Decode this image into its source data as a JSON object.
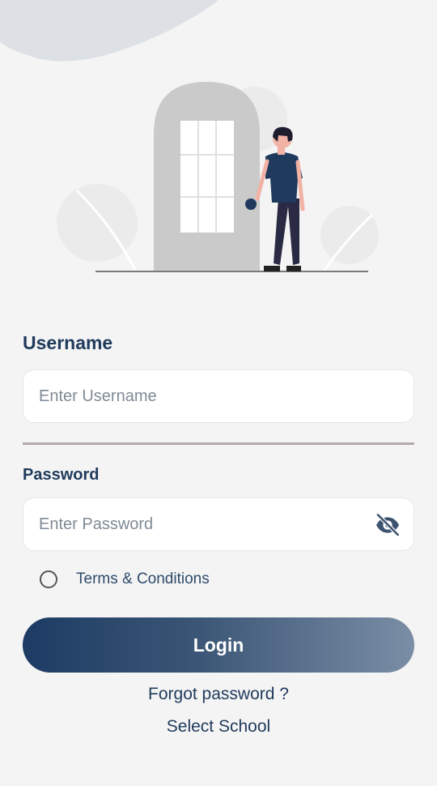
{
  "form": {
    "username_label": "Username",
    "username_placeholder": "Enter Username",
    "username_value": "",
    "password_label": "Password",
    "password_placeholder": "Enter Password",
    "password_value": "",
    "terms_label": "Terms & Conditions",
    "terms_checked": false,
    "login_label": "Login",
    "forgot_label": "Forgot password ?",
    "school_label": "Select School"
  },
  "icons": {
    "password_toggle": "eye-slash-icon",
    "illustration": "person-at-door-illustration"
  },
  "colors": {
    "background": "#f4f4f4",
    "primary": "#1f3a5c",
    "button_start": "#1d3b63",
    "button_end": "#7b8ea6",
    "divider": "#b3aaaa"
  }
}
